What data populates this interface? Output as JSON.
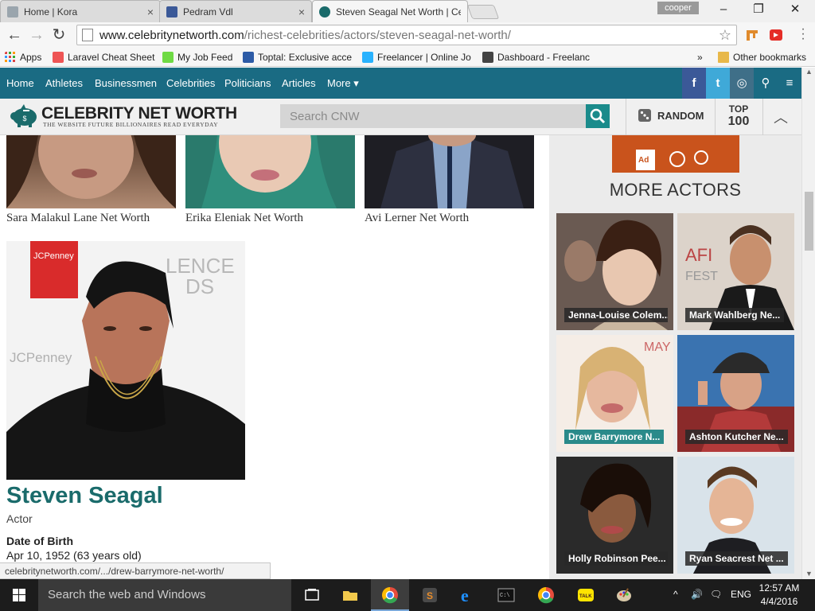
{
  "browser": {
    "tabs": [
      {
        "title": "Home | Kora",
        "favicon": "kora-icon",
        "color": "#9aa5ad"
      },
      {
        "title": "Pedram Vdl",
        "favicon": "facebook-icon",
        "color": "#3b5998"
      },
      {
        "title": "Steven Seagal Net Worth | Celebrity Net Worth",
        "favicon": "cnw-pig-icon",
        "color": "#1a6b6b",
        "active": true
      }
    ],
    "profile_name": "cooper",
    "url_domain": "www.celebritynetworth.com",
    "url_path": "/richest-celebrities/actors/steven-seagal-net-worth/",
    "window_controls": {
      "minimize": "–",
      "maximize": "❐",
      "close": "✕"
    }
  },
  "bookmarks": {
    "items": [
      {
        "label": "Apps",
        "icon": "apps-grid-icon",
        "color": "#d44"
      },
      {
        "label": "Laravel Cheat Sheet",
        "icon": "laravel-icon",
        "color": "#e55"
      },
      {
        "label": "My Job Feed",
        "icon": "upwork-icon",
        "color": "#6fda44"
      },
      {
        "label": "Toptal: Exclusive acce",
        "icon": "toptal-icon",
        "color": "#2d5ba6"
      },
      {
        "label": "Freelancer | Online Jo",
        "icon": "freelancer-icon",
        "color": "#29b2fe"
      },
      {
        "label": "Dashboard - Freelanc",
        "icon": "dashboard-icon",
        "color": "#444"
      }
    ],
    "overflow": "»",
    "other_label": "Other bookmarks"
  },
  "site_nav": {
    "links": [
      "Home",
      "Athletes",
      "Businessmen",
      "Celebrities",
      "Politicians",
      "Articles",
      "More ▾"
    ],
    "social": [
      {
        "icon": "facebook-icon",
        "glyph": "f",
        "color": "#3b5998"
      },
      {
        "icon": "twitter-icon",
        "glyph": "t",
        "color": "#3fa9d8"
      },
      {
        "icon": "instagram-icon",
        "glyph": "◎",
        "color": "#3f6f88"
      },
      {
        "icon": "location-pin-icon",
        "glyph": "⚲",
        "color": "#1a6b83"
      },
      {
        "icon": "hamburger-menu-icon",
        "glyph": "≡",
        "color": "#1a6b83"
      }
    ]
  },
  "header": {
    "logo_title": "CELEBRITY NET WORTH",
    "logo_subtitle": "THE WEBSITE FUTURE BILLIONAIRES READ EVERYDAY",
    "search_placeholder": "Search CNW",
    "random_label": "RANDOM",
    "top_label": "TOP",
    "top_number": "100"
  },
  "related": [
    {
      "caption": "Sara Malakul Lane Net Worth",
      "color": "#7a5a46"
    },
    {
      "caption": "Erika Eleniak Net Worth",
      "color": "#2f8f7d"
    },
    {
      "caption": "Avi Lerner Net Worth",
      "color": "#2b2f3e"
    }
  ],
  "profile": {
    "name": "Steven Seagal",
    "role": "Actor",
    "dob_label": "Date of Birth",
    "dob_value": "Apr 10, 1952 (63 years old)"
  },
  "sidebar": {
    "title": "MORE ACTORS",
    "actors": [
      {
        "caption": "Jenna-Louise Colem...",
        "teal": false,
        "bg": "#8a5a4a"
      },
      {
        "caption": "Mark Wahlberg Ne...",
        "teal": false,
        "bg": "#c7b8a8"
      },
      {
        "caption": "Drew Barrymore N...",
        "teal": true,
        "bg": "#c99a82"
      },
      {
        "caption": "Ashton Kutcher Ne...",
        "teal": false,
        "bg": "#3a6a9a"
      },
      {
        "caption": "Holly Robinson Pee...",
        "teal": false,
        "bg": "#5a3a2e"
      },
      {
        "caption": "Ryan Seacrest Net ...",
        "teal": false,
        "bg": "#b8c6d0"
      }
    ]
  },
  "status_url": "celebritynetworth.com/.../drew-barrymore-net-worth/",
  "taskbar": {
    "search_placeholder": "Search the web and Windows",
    "apps": [
      {
        "name": "task-view-icon",
        "color": "#ffffff"
      },
      {
        "name": "file-explorer-icon",
        "color": "#f2c94c"
      },
      {
        "name": "chrome-icon",
        "color": "#e74c3c",
        "active": true
      },
      {
        "name": "sublime-text-icon",
        "color": "#e98d2a"
      },
      {
        "name": "internet-explorer-icon",
        "color": "#1e90ff"
      },
      {
        "name": "command-prompt-icon",
        "color": "#111111"
      },
      {
        "name": "chrome-icon",
        "color": "#e74c3c"
      },
      {
        "name": "kakaotalk-icon",
        "color": "#ffe400"
      },
      {
        "name": "paint-icon",
        "color": "#8aa"
      }
    ],
    "tray": {
      "chevron": "^",
      "volume": "🔊",
      "notifications": "🗨",
      "language": "ENG"
    },
    "time": "12:57 AM",
    "date": "4/4/2016"
  }
}
